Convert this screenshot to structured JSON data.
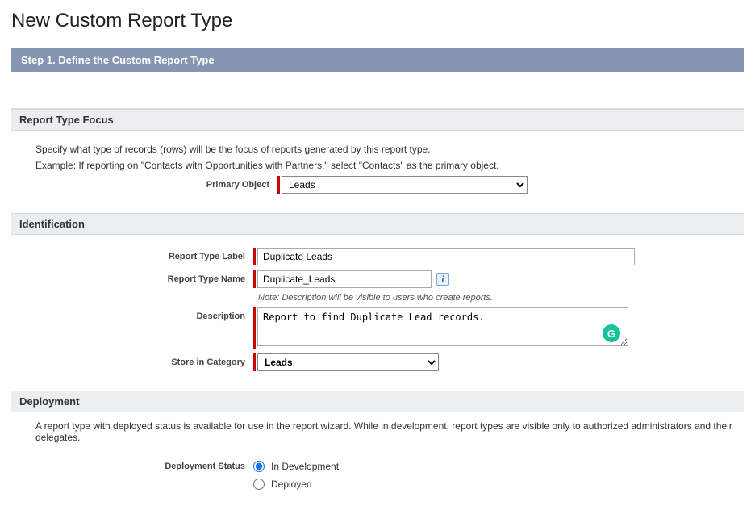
{
  "page": {
    "title": "New Custom Report Type"
  },
  "step": {
    "label": "Step 1. Define the Custom Report Type"
  },
  "focus": {
    "heading": "Report Type Focus",
    "help1": "Specify what type of records (rows) will be the focus of reports generated by this report type.",
    "help2": "Example: If reporting on \"Contacts with Opportunities with Partners,\" select \"Contacts\" as the primary object.",
    "primary_object_label": "Primary Object",
    "primary_object_value": "Leads"
  },
  "identification": {
    "heading": "Identification",
    "label_label": "Report Type Label",
    "label_value": "Duplicate Leads",
    "name_label": "Report Type Name",
    "name_value": "Duplicate_Leads",
    "note": "Note: Description will be visible to users who create reports.",
    "description_label": "Description",
    "description_value": "Report to find Duplicate Lead records.",
    "category_label": "Store in Category",
    "category_value": "Leads",
    "grammarly_badge": "G"
  },
  "deployment": {
    "heading": "Deployment",
    "help": "A report type with deployed status is available for use in the report wizard. While in development, report types are visible only to authorized administrators and their delegates.",
    "status_label": "Deployment Status",
    "option_dev": "In Development",
    "option_deployed": "Deployed",
    "selected": "dev"
  },
  "info_icon": "i"
}
